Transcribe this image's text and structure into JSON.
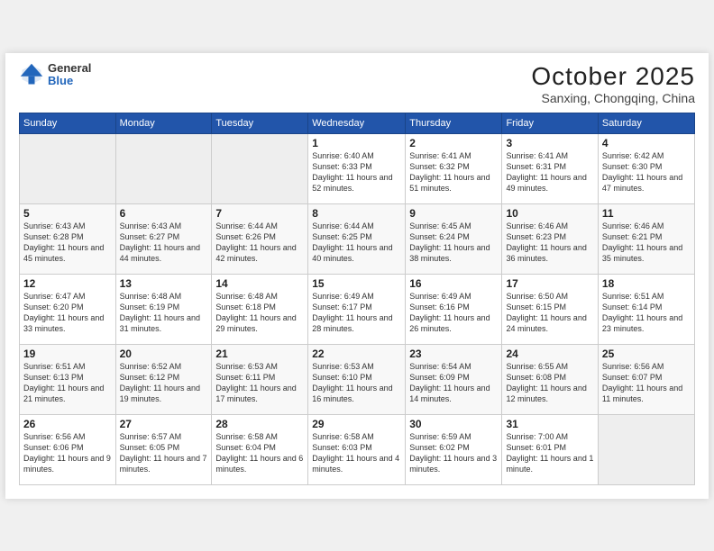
{
  "header": {
    "logo_general": "General",
    "logo_blue": "Blue",
    "month_title": "October 2025",
    "subtitle": "Sanxing, Chongqing, China"
  },
  "weekdays": [
    "Sunday",
    "Monday",
    "Tuesday",
    "Wednesday",
    "Thursday",
    "Friday",
    "Saturday"
  ],
  "weeks": [
    [
      {
        "day": "",
        "info": ""
      },
      {
        "day": "",
        "info": ""
      },
      {
        "day": "",
        "info": ""
      },
      {
        "day": "1",
        "info": "Sunrise: 6:40 AM\nSunset: 6:33 PM\nDaylight: 11 hours and 52 minutes."
      },
      {
        "day": "2",
        "info": "Sunrise: 6:41 AM\nSunset: 6:32 PM\nDaylight: 11 hours and 51 minutes."
      },
      {
        "day": "3",
        "info": "Sunrise: 6:41 AM\nSunset: 6:31 PM\nDaylight: 11 hours and 49 minutes."
      },
      {
        "day": "4",
        "info": "Sunrise: 6:42 AM\nSunset: 6:30 PM\nDaylight: 11 hours and 47 minutes."
      }
    ],
    [
      {
        "day": "5",
        "info": "Sunrise: 6:43 AM\nSunset: 6:28 PM\nDaylight: 11 hours and 45 minutes."
      },
      {
        "day": "6",
        "info": "Sunrise: 6:43 AM\nSunset: 6:27 PM\nDaylight: 11 hours and 44 minutes."
      },
      {
        "day": "7",
        "info": "Sunrise: 6:44 AM\nSunset: 6:26 PM\nDaylight: 11 hours and 42 minutes."
      },
      {
        "day": "8",
        "info": "Sunrise: 6:44 AM\nSunset: 6:25 PM\nDaylight: 11 hours and 40 minutes."
      },
      {
        "day": "9",
        "info": "Sunrise: 6:45 AM\nSunset: 6:24 PM\nDaylight: 11 hours and 38 minutes."
      },
      {
        "day": "10",
        "info": "Sunrise: 6:46 AM\nSunset: 6:23 PM\nDaylight: 11 hours and 36 minutes."
      },
      {
        "day": "11",
        "info": "Sunrise: 6:46 AM\nSunset: 6:21 PM\nDaylight: 11 hours and 35 minutes."
      }
    ],
    [
      {
        "day": "12",
        "info": "Sunrise: 6:47 AM\nSunset: 6:20 PM\nDaylight: 11 hours and 33 minutes."
      },
      {
        "day": "13",
        "info": "Sunrise: 6:48 AM\nSunset: 6:19 PM\nDaylight: 11 hours and 31 minutes."
      },
      {
        "day": "14",
        "info": "Sunrise: 6:48 AM\nSunset: 6:18 PM\nDaylight: 11 hours and 29 minutes."
      },
      {
        "day": "15",
        "info": "Sunrise: 6:49 AM\nSunset: 6:17 PM\nDaylight: 11 hours and 28 minutes."
      },
      {
        "day": "16",
        "info": "Sunrise: 6:49 AM\nSunset: 6:16 PM\nDaylight: 11 hours and 26 minutes."
      },
      {
        "day": "17",
        "info": "Sunrise: 6:50 AM\nSunset: 6:15 PM\nDaylight: 11 hours and 24 minutes."
      },
      {
        "day": "18",
        "info": "Sunrise: 6:51 AM\nSunset: 6:14 PM\nDaylight: 11 hours and 23 minutes."
      }
    ],
    [
      {
        "day": "19",
        "info": "Sunrise: 6:51 AM\nSunset: 6:13 PM\nDaylight: 11 hours and 21 minutes."
      },
      {
        "day": "20",
        "info": "Sunrise: 6:52 AM\nSunset: 6:12 PM\nDaylight: 11 hours and 19 minutes."
      },
      {
        "day": "21",
        "info": "Sunrise: 6:53 AM\nSunset: 6:11 PM\nDaylight: 11 hours and 17 minutes."
      },
      {
        "day": "22",
        "info": "Sunrise: 6:53 AM\nSunset: 6:10 PM\nDaylight: 11 hours and 16 minutes."
      },
      {
        "day": "23",
        "info": "Sunrise: 6:54 AM\nSunset: 6:09 PM\nDaylight: 11 hours and 14 minutes."
      },
      {
        "day": "24",
        "info": "Sunrise: 6:55 AM\nSunset: 6:08 PM\nDaylight: 11 hours and 12 minutes."
      },
      {
        "day": "25",
        "info": "Sunrise: 6:56 AM\nSunset: 6:07 PM\nDaylight: 11 hours and 11 minutes."
      }
    ],
    [
      {
        "day": "26",
        "info": "Sunrise: 6:56 AM\nSunset: 6:06 PM\nDaylight: 11 hours and 9 minutes."
      },
      {
        "day": "27",
        "info": "Sunrise: 6:57 AM\nSunset: 6:05 PM\nDaylight: 11 hours and 7 minutes."
      },
      {
        "day": "28",
        "info": "Sunrise: 6:58 AM\nSunset: 6:04 PM\nDaylight: 11 hours and 6 minutes."
      },
      {
        "day": "29",
        "info": "Sunrise: 6:58 AM\nSunset: 6:03 PM\nDaylight: 11 hours and 4 minutes."
      },
      {
        "day": "30",
        "info": "Sunrise: 6:59 AM\nSunset: 6:02 PM\nDaylight: 11 hours and 3 minutes."
      },
      {
        "day": "31",
        "info": "Sunrise: 7:00 AM\nSunset: 6:01 PM\nDaylight: 11 hours and 1 minute."
      },
      {
        "day": "",
        "info": ""
      }
    ]
  ]
}
